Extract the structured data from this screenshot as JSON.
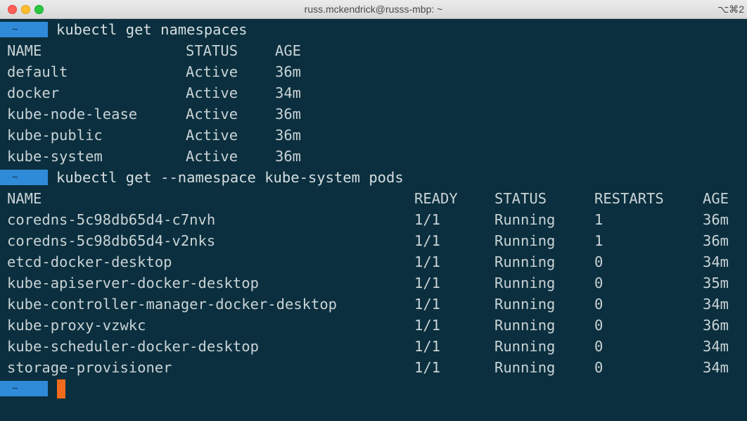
{
  "window": {
    "title": "russ.mckendrick@russs-mbp: ~",
    "shortcut": "⌥⌘2"
  },
  "prompt_symbol": "~",
  "commands": {
    "cmd1": "kubectl get namespaces",
    "cmd2": "kubectl get --namespace kube-system pods"
  },
  "namespaces": {
    "headers": [
      "NAME",
      "STATUS",
      "AGE"
    ],
    "rows": [
      [
        "default",
        "Active",
        "36m"
      ],
      [
        "docker",
        "Active",
        "34m"
      ],
      [
        "kube-node-lease",
        "Active",
        "36m"
      ],
      [
        "kube-public",
        "Active",
        "36m"
      ],
      [
        "kube-system",
        "Active",
        "36m"
      ]
    ]
  },
  "pods": {
    "headers": [
      "NAME",
      "READY",
      "STATUS",
      "RESTARTS",
      "AGE"
    ],
    "rows": [
      [
        "coredns-5c98db65d4-c7nvh",
        "1/1",
        "Running",
        "1",
        "36m"
      ],
      [
        "coredns-5c98db65d4-v2nks",
        "1/1",
        "Running",
        "1",
        "36m"
      ],
      [
        "etcd-docker-desktop",
        "1/1",
        "Running",
        "0",
        "34m"
      ],
      [
        "kube-apiserver-docker-desktop",
        "1/1",
        "Running",
        "0",
        "35m"
      ],
      [
        "kube-controller-manager-docker-desktop",
        "1/1",
        "Running",
        "0",
        "34m"
      ],
      [
        "kube-proxy-vzwkc",
        "1/1",
        "Running",
        "0",
        "36m"
      ],
      [
        "kube-scheduler-docker-desktop",
        "1/1",
        "Running",
        "0",
        "34m"
      ],
      [
        "storage-provisioner",
        "1/1",
        "Running",
        "0",
        "34m"
      ]
    ]
  },
  "colors": {
    "background": "#0b2f3e",
    "text": "#c9d3d6",
    "prompt": "#2f8ad8",
    "cursor": "#f26b1d"
  }
}
